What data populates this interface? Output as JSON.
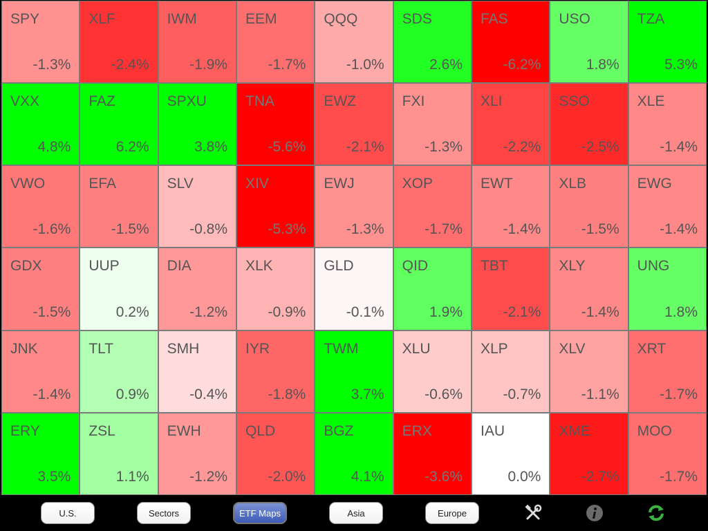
{
  "grid": [
    {
      "symbol": "SPY",
      "change": "-1.3%",
      "value": -1.3
    },
    {
      "symbol": "XLF",
      "change": "-2.4%",
      "value": -2.4
    },
    {
      "symbol": "IWM",
      "change": "-1.9%",
      "value": -1.9
    },
    {
      "symbol": "EEM",
      "change": "-1.7%",
      "value": -1.7
    },
    {
      "symbol": "QQQ",
      "change": "-1.0%",
      "value": -1.0
    },
    {
      "symbol": "SDS",
      "change": "2.6%",
      "value": 2.6
    },
    {
      "symbol": "FAS",
      "change": "-6.2%",
      "value": -6.2
    },
    {
      "symbol": "USO",
      "change": "1.8%",
      "value": 1.8
    },
    {
      "symbol": "TZA",
      "change": "5.3%",
      "value": 5.3
    },
    {
      "symbol": "VXX",
      "change": "4.8%",
      "value": 4.8
    },
    {
      "symbol": "FAZ",
      "change": "6.2%",
      "value": 6.2
    },
    {
      "symbol": "SPXU",
      "change": "3.8%",
      "value": 3.8
    },
    {
      "symbol": "TNA",
      "change": "-5.6%",
      "value": -5.6
    },
    {
      "symbol": "EWZ",
      "change": "-2.1%",
      "value": -2.1
    },
    {
      "symbol": "FXI",
      "change": "-1.3%",
      "value": -1.3
    },
    {
      "symbol": "XLI",
      "change": "-2.2%",
      "value": -2.2
    },
    {
      "symbol": "SSO",
      "change": "-2.5%",
      "value": -2.5
    },
    {
      "symbol": "XLE",
      "change": "-1.4%",
      "value": -1.4
    },
    {
      "symbol": "VWO",
      "change": "-1.6%",
      "value": -1.6
    },
    {
      "symbol": "EFA",
      "change": "-1.5%",
      "value": -1.5
    },
    {
      "symbol": "SLV",
      "change": "-0.8%",
      "value": -0.8
    },
    {
      "symbol": "XIV",
      "change": "-5.3%",
      "value": -5.3
    },
    {
      "symbol": "EWJ",
      "change": "-1.3%",
      "value": -1.3
    },
    {
      "symbol": "XOP",
      "change": "-1.7%",
      "value": -1.7
    },
    {
      "symbol": "EWT",
      "change": "-1.4%",
      "value": -1.4
    },
    {
      "symbol": "XLB",
      "change": "-1.5%",
      "value": -1.5
    },
    {
      "symbol": "EWG",
      "change": "-1.4%",
      "value": -1.4
    },
    {
      "symbol": "GDX",
      "change": "-1.5%",
      "value": -1.5
    },
    {
      "symbol": "UUP",
      "change": "0.2%",
      "value": 0.2
    },
    {
      "symbol": "DIA",
      "change": "-1.2%",
      "value": -1.2
    },
    {
      "symbol": "XLK",
      "change": "-0.9%",
      "value": -0.9
    },
    {
      "symbol": "GLD",
      "change": "-0.1%",
      "value": -0.1
    },
    {
      "symbol": "QID",
      "change": "1.9%",
      "value": 1.9
    },
    {
      "symbol": "TBT",
      "change": "-2.1%",
      "value": -2.1
    },
    {
      "symbol": "XLY",
      "change": "-1.4%",
      "value": -1.4
    },
    {
      "symbol": "UNG",
      "change": "1.8%",
      "value": 1.8
    },
    {
      "symbol": "JNK",
      "change": "-1.4%",
      "value": -1.4
    },
    {
      "symbol": "TLT",
      "change": "0.9%",
      "value": 0.9
    },
    {
      "symbol": "SMH",
      "change": "-0.4%",
      "value": -0.4
    },
    {
      "symbol": "IYR",
      "change": "-1.8%",
      "value": -1.8
    },
    {
      "symbol": "TWM",
      "change": "3.7%",
      "value": 3.7
    },
    {
      "symbol": "XLU",
      "change": "-0.6%",
      "value": -0.6
    },
    {
      "symbol": "XLP",
      "change": "-0.7%",
      "value": -0.7
    },
    {
      "symbol": "XLV",
      "change": "-1.1%",
      "value": -1.1
    },
    {
      "symbol": "XRT",
      "change": "-1.7%",
      "value": -1.7
    },
    {
      "symbol": "ERY",
      "change": "3.5%",
      "value": 3.5
    },
    {
      "symbol": "ZSL",
      "change": "1.1%",
      "value": 1.1
    },
    {
      "symbol": "EWH",
      "change": "-1.2%",
      "value": -1.2
    },
    {
      "symbol": "QLD",
      "change": "-2.0%",
      "value": -2.0
    },
    {
      "symbol": "BGZ",
      "change": "4.1%",
      "value": 4.1
    },
    {
      "symbol": "ERX",
      "change": "-3.6%",
      "value": -3.6
    },
    {
      "symbol": "IAU",
      "change": "0.0%",
      "value": 0.0
    },
    {
      "symbol": "XME",
      "change": "-2.7%",
      "value": -2.7
    },
    {
      "symbol": "MOO",
      "change": "-1.7%",
      "value": -1.7
    }
  ],
  "colors": {
    "up": "#00ff00",
    "down": "#ff0000",
    "neutral": "#ffffff",
    "scale_pct": 3.0
  },
  "toolbar": {
    "buttons": [
      {
        "label": "U.S.",
        "active": false
      },
      {
        "label": "Sectors",
        "active": false
      },
      {
        "label": "ETF Maps",
        "active": true
      },
      {
        "label": "Asia",
        "active": false
      },
      {
        "label": "Europe",
        "active": false
      }
    ],
    "icons": [
      "tools-icon",
      "info-icon",
      "refresh-icon"
    ]
  }
}
